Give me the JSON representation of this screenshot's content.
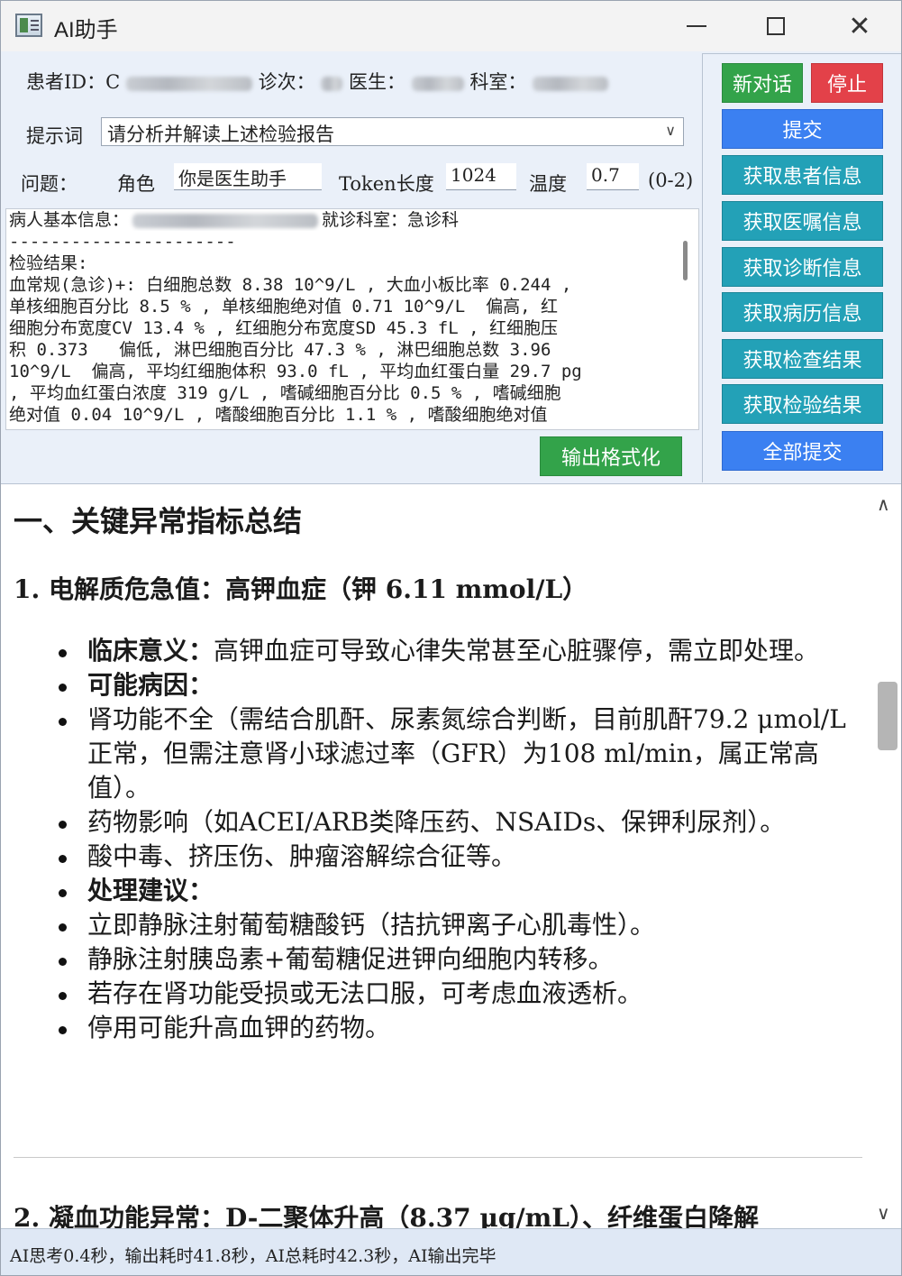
{
  "window": {
    "title": "AI助手"
  },
  "info": {
    "patient_id_label": "患者ID：",
    "patient_id_prefix": "C",
    "visit_label": "诊次：",
    "doctor_label": "医生：",
    "dept_label": "科室："
  },
  "prompt": {
    "label": "提示词",
    "selected": "请分析并解读上述检验报告"
  },
  "params": {
    "question_label": "问题：",
    "role_label": "角色",
    "role_value": "你是医生助手",
    "token_label": "Token长度",
    "token_value": "1024",
    "temp_label": "温度",
    "temp_value": "0.7",
    "temp_range": "(0-2)"
  },
  "report": {
    "lines": [
      "病人基本信息：",
      "就诊科室：急诊科",
      "----------------------",
      "检验结果:",
      "血常规(急诊)+: 白细胞总数 8.38 10^9/L , 大血小板比率 0.244 ,",
      "单核细胞百分比 8.5 % , 单核细胞绝对值 0.71 10^9/L  偏高, 红",
      "细胞分布宽度CV 13.4 % , 红细胞分布宽度SD 45.3 fL , 红细胞压",
      "积 0.373   偏低, 淋巴细胞百分比 47.3 % , 淋巴细胞总数 3.96",
      "10^9/L  偏高, 平均红细胞体积 93.0 fL , 平均血红蛋白量 29.7 pg",
      ", 平均血红蛋白浓度 319 g/L , 嗜碱细胞百分比 0.5 % , 嗜碱细胞",
      "绝对值 0.04 10^9/L , 嗜酸细胞百分比 1.1 % , 嗜酸细胞绝对值"
    ]
  },
  "buttons": {
    "format": "输出格式化",
    "new_chat": "新对话",
    "stop": "停止",
    "submit": "提交",
    "get_patient": "获取患者信息",
    "get_orders": "获取医嘱信息",
    "get_diagnosis": "获取诊断信息",
    "get_history": "获取病历信息",
    "get_exam": "获取检查结果",
    "get_lab": "获取检验结果",
    "submit_all": "全部提交"
  },
  "output": {
    "heading1": "一、关键异常指标总结",
    "section1": "1. 电解质危急值：高钾血症（钾  6.11 mmol/L）",
    "bullets": [
      {
        "bold": "临床意义：",
        "text": "高钾血症可导致心律失常甚至心脏骤停，需立即处理。"
      },
      {
        "bold": "可能病因：",
        "text": ""
      },
      {
        "bold": "",
        "text": "肾功能不全（需结合肌酐、尿素氮综合判断，目前肌酐79.2 μmol/L正常，但需注意肾小球滤过率（GFR）为108 ml/min，属正常高值）。"
      },
      {
        "bold": "",
        "text": "药物影响（如ACEI/ARB类降压药、NSAIDs、保钾利尿剂）。"
      },
      {
        "bold": "",
        "text": "酸中毒、挤压伤、肿瘤溶解综合征等。"
      },
      {
        "bold": "处理建议：",
        "text": ""
      },
      {
        "bold": "",
        "text": "立即静脉注射葡萄糖酸钙（拮抗钾离子心肌毒性）。"
      },
      {
        "bold": "",
        "text": "静脉注射胰岛素+葡萄糖促进钾向细胞内转移。"
      },
      {
        "bold": "",
        "text": "若存在肾功能受损或无法口服，可考虑血液透析。"
      },
      {
        "bold": "",
        "text": "停用可能升高血钾的药物。"
      }
    ],
    "section2": "2. 凝血功能异常：D-二聚体升高（8.37 μg/mL）、纤维蛋白降解"
  },
  "status": {
    "text": "AI思考0.4秒，输出耗时41.8秒，AI总耗时42.3秒，AI输出完毕"
  },
  "colors": {
    "green": "#33a34a",
    "red": "#e34149",
    "blue": "#3b80f1",
    "teal": "#23a1b7"
  }
}
